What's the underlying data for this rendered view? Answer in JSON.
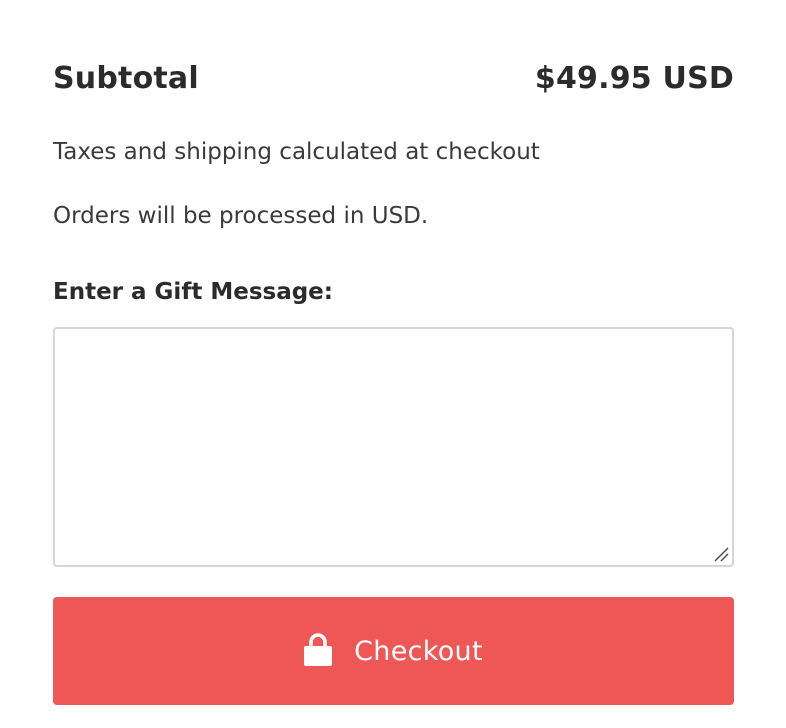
{
  "subtotal": {
    "label": "Subtotal",
    "value": "$49.95 USD"
  },
  "notes": {
    "taxes": "Taxes and shipping calculated at checkout",
    "currency": "Orders will be processed in USD."
  },
  "gift_message": {
    "label": "Enter a Gift Message:",
    "value": "",
    "placeholder": ""
  },
  "checkout": {
    "icon": "lock-icon",
    "label": "Checkout"
  },
  "colors": {
    "accent": "#ee5755",
    "text": "#2b2b2b",
    "border": "#d6d6d6"
  }
}
